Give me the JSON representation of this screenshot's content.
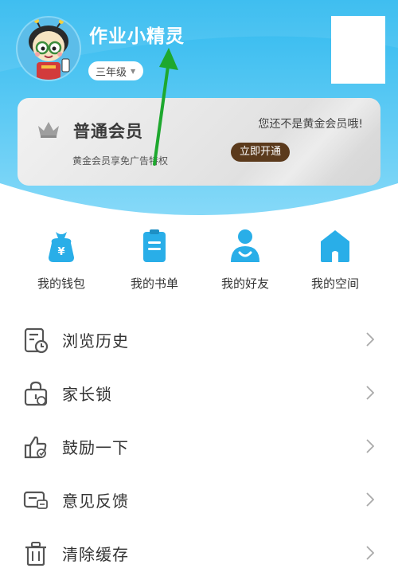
{
  "profile": {
    "username": "作业小精灵",
    "grade": "三年级",
    "grade_caret_icon": "caret-down-icon"
  },
  "member_card": {
    "title": "普通会员",
    "subtitle": "黄金会员享免广告特权",
    "hint": "您还不是黄金会员哦!",
    "open_button": "立即开通",
    "crown_icon": "crown-icon"
  },
  "quick_actions": [
    {
      "label": "我的钱包",
      "icon": "wallet-icon"
    },
    {
      "label": "我的书单",
      "icon": "booklist-icon"
    },
    {
      "label": "我的好友",
      "icon": "friends-icon"
    },
    {
      "label": "我的空间",
      "icon": "home-space-icon"
    }
  ],
  "menu": [
    {
      "label": "浏览历史",
      "icon": "history-icon"
    },
    {
      "label": "家长锁",
      "icon": "parent-lock-icon"
    },
    {
      "label": "鼓励一下",
      "icon": "thumbs-up-icon"
    },
    {
      "label": "意见反馈",
      "icon": "feedback-icon"
    },
    {
      "label": "清除缓存",
      "icon": "trash-icon"
    }
  ],
  "colors": {
    "header_gradient_top": "#3fc0f0",
    "header_gradient_bottom": "#7dd6f7",
    "icon_blue": "#29aee8",
    "member_button": "#5b3a1c",
    "annotation_arrow": "#1ea82e"
  }
}
